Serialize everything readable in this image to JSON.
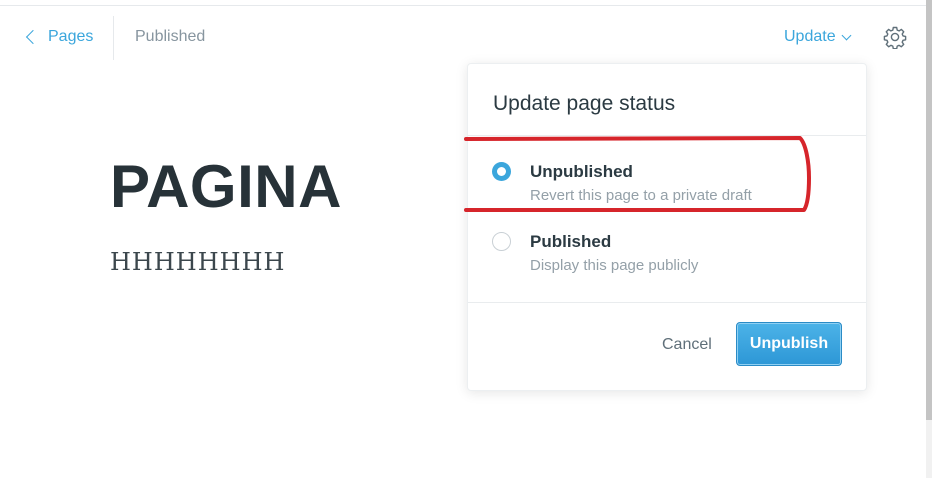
{
  "header": {
    "back_label": "Pages",
    "status": "Published",
    "update_label": "Update"
  },
  "page": {
    "title": "PAGINA",
    "body": "HHHHHHHH"
  },
  "popover": {
    "title": "Update page status",
    "options": [
      {
        "label": "Unpublished",
        "description": "Revert this page to a private draft",
        "selected": true
      },
      {
        "label": "Published",
        "description": "Display this page publicly",
        "selected": false
      }
    ],
    "cancel_label": "Cancel",
    "confirm_label": "Unpublish"
  },
  "colors": {
    "accent": "#3ba6dc",
    "annotation": "#d6252b",
    "title_text": "#273238"
  },
  "icons": {
    "back": "chevron-left-icon",
    "update": "chevron-down-icon",
    "settings": "gear-icon"
  }
}
